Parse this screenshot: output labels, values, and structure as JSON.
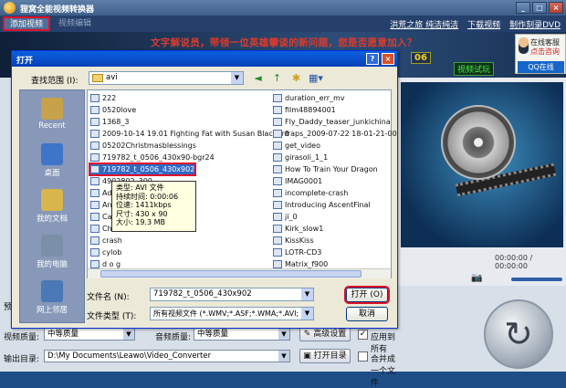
{
  "app": {
    "title": "狸窝全能视频转换器",
    "win_min": "_",
    "win_max": "□",
    "win_close": "×"
  },
  "toolbar": {
    "add_video": "添加视频",
    "add_video2": "视频编辑",
    "links": [
      "洪荒之旅 纯洁纯洁",
      "下载视频",
      "制作刻录DVD"
    ]
  },
  "banner": {
    "text": "文字解说员，带领一位英雄攀谈的新问题，您是否愿意加入？",
    "badge": "06",
    "trial": "视频试玩"
  },
  "service": {
    "line1": "在线客服",
    "line2": "点击咨询",
    "qq": "QQ在线"
  },
  "player": {
    "time": "00:00:00 / 00:00:00",
    "controls": "◀ ▶ 📷 🔊"
  },
  "dialog": {
    "title": "打开",
    "help": "?",
    "close": "×",
    "lookin_label": "查找范围 (I):",
    "lookin_value": "avi",
    "nav_icons": [
      "◄",
      "↑",
      "✱",
      "▦▾"
    ],
    "places": [
      {
        "label": "Recent",
        "color": "#c6a24a"
      },
      {
        "label": "桌面",
        "color": "#3d75c8"
      },
      {
        "label": "我的文档",
        "color": "#d7b64b"
      },
      {
        "label": "我的电脑",
        "color": "#7c8fa8"
      },
      {
        "label": "网上邻居",
        "color": "#4b78b6"
      }
    ],
    "files_col1": [
      "222",
      "0520love",
      "1368_3",
      "2009-10-14 19.01 Fighting Fat with Susan Blackard",
      "05202Christmasblessings",
      "719782_t_0506_430x90-bgr24",
      "719782_t_0506_430x902",
      "4902802_300",
      "Adoi",
      "Anto",
      "Casp",
      "Che",
      "crash",
      "cylob",
      "d o g"
    ],
    "files_col2": [
      "duration_err_mv",
      "film48894001",
      "Fly_Daddy_teaser_junkichina",
      "fraps_2009-07-22 18-01-21-00",
      "get_video",
      "girasoli_1_1",
      "How To Train Your Dragon",
      "IMAG0001",
      "incomplete-crash",
      "Introducing AscentFinal",
      "ji_0",
      "Kirk_slow1",
      "KissKiss",
      "LOTR-CD3",
      "Matrix_f900"
    ],
    "tooltip": [
      "类型: AVI 文件",
      "持续时间: 0:00:06",
      "位速: 1411kbps",
      "尺寸: 430 x 90",
      "大小: 19.3 MB"
    ],
    "filename_label": "文件名 (N):",
    "filename_value": "719782_t_0506_430x902",
    "filetype_label": "文件类型 (T):",
    "filetype_value": "所有视频文件 (*.WMV;*.ASF;*.WMA;*.AVI;",
    "open_btn": "打开 (O)",
    "cancel_btn": "取消"
  },
  "lower": {
    "preset_label": "预",
    "video_quality_label": "视频质量:",
    "video_quality_value": "中等质量",
    "audio_quality_label": "音频质量:",
    "audio_quality_value": "中等质量",
    "advanced_btn": "高级设置",
    "apply_all_label": "应用到所有",
    "output_label": "输出目录:",
    "output_value": "D:\\My Documents\\Leawo\\Video_Converter",
    "open_dir_btn": "打开目录",
    "merge_label": "合并成一个文件"
  }
}
